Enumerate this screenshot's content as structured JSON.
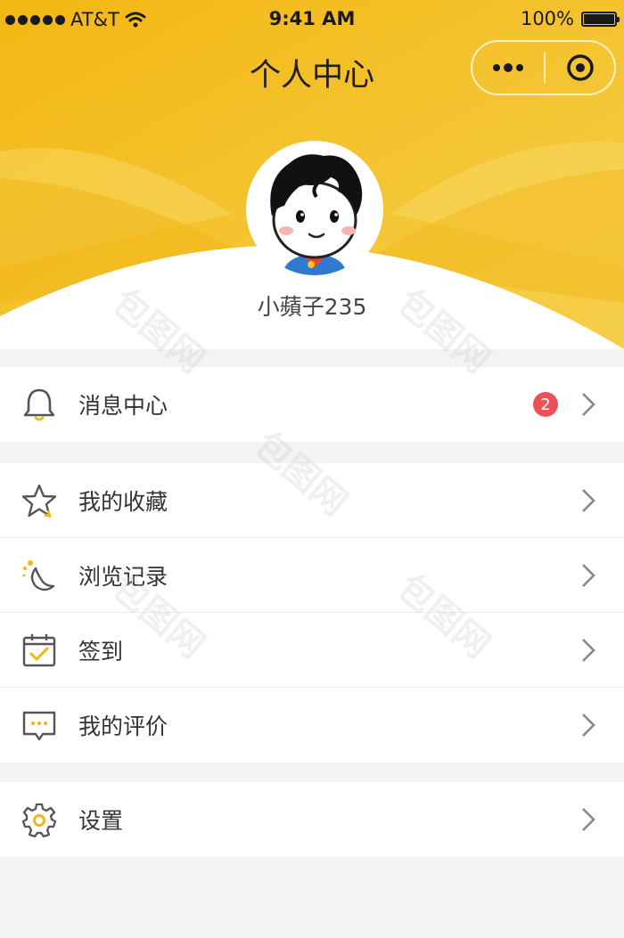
{
  "status_bar": {
    "carrier": "AT&T",
    "time": "9:41 AM",
    "battery": "100%"
  },
  "header": {
    "title": "个人中心",
    "username": "小蘋子235",
    "accent_color": "#f1c230"
  },
  "menu": {
    "group1": [
      {
        "label": "消息中心",
        "icon": "bell-icon",
        "badge": "2"
      }
    ],
    "group2": [
      {
        "label": "我的收藏",
        "icon": "star-icon"
      },
      {
        "label": "浏览记录",
        "icon": "history-moon-icon"
      },
      {
        "label": "签到",
        "icon": "calendar-check-icon"
      },
      {
        "label": "我的评价",
        "icon": "comment-icon"
      }
    ],
    "group3": [
      {
        "label": "设置",
        "icon": "gear-icon"
      }
    ]
  },
  "watermark": "包图网",
  "badge_color": "#ec5156"
}
